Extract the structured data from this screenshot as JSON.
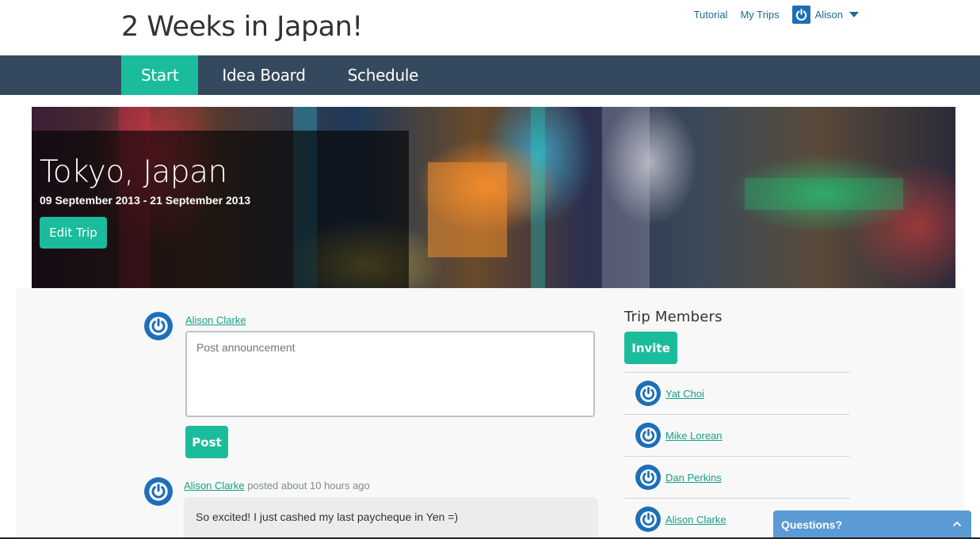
{
  "header": {
    "title": "2 Weeks in Japan!",
    "links": {
      "tutorial": "Tutorial",
      "my_trips": "My Trips"
    },
    "user_name": "Alison"
  },
  "nav": {
    "tabs": [
      {
        "label": "Start",
        "active": true
      },
      {
        "label": "Idea Board",
        "active": false
      },
      {
        "label": "Schedule",
        "active": false
      }
    ]
  },
  "hero": {
    "city": "Tokyo, Japan",
    "dates": "09 September 2013 - 21 September 2013",
    "edit_label": "Edit Trip"
  },
  "announcement": {
    "author": "Alison Clarke",
    "placeholder": "Post announcement",
    "post_label": "Post"
  },
  "feed": {
    "posts": [
      {
        "author": "Alison Clarke",
        "meta": " posted about 10 hours ago",
        "body": "So excited! I just cashed my last paycheque in Yen =)"
      }
    ]
  },
  "members": {
    "title": "Trip Members",
    "invite_label": "Invite",
    "list": [
      {
        "name": "Yat Choi"
      },
      {
        "name": "Mike Lorean"
      },
      {
        "name": "Dan Perkins"
      },
      {
        "name": "Alison Clarke"
      }
    ]
  },
  "help_widget": {
    "label": "Questions?"
  },
  "colors": {
    "accent": "#1abc9c",
    "navbar": "#34495e",
    "link": "#16a085",
    "avatar": "#1d6fb8",
    "help": "#5b9bd5"
  },
  "icons": {
    "avatar": "power-icon",
    "user_menu_caret": "caret-down-icon",
    "help_toggle": "chevron-up-icon"
  }
}
